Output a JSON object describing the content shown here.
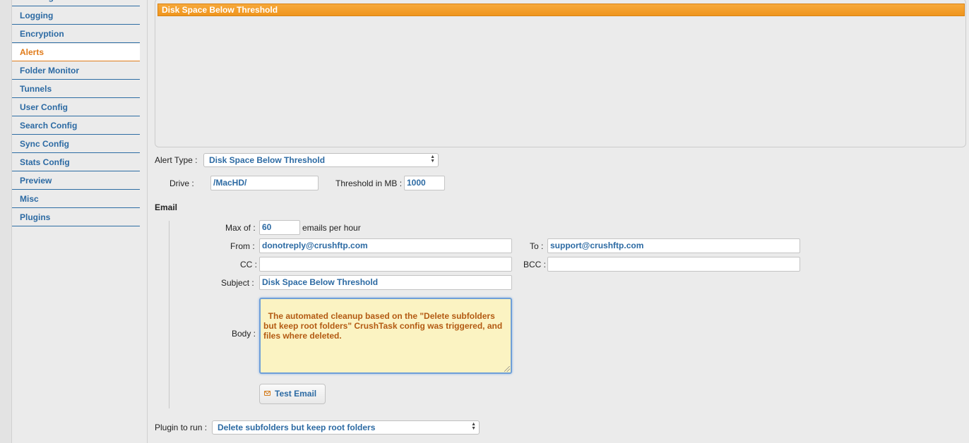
{
  "sidebar": {
    "items": [
      {
        "label": "Banning"
      },
      {
        "label": "Logging"
      },
      {
        "label": "Encryption"
      },
      {
        "label": "Alerts",
        "active": true
      },
      {
        "label": "Folder Monitor"
      },
      {
        "label": "Tunnels"
      },
      {
        "label": "User Config"
      },
      {
        "label": "Search Config"
      },
      {
        "label": "Sync Config"
      },
      {
        "label": "Stats Config"
      },
      {
        "label": "Preview"
      },
      {
        "label": "Misc"
      },
      {
        "label": "Plugins"
      }
    ]
  },
  "alerts_list": {
    "selected": "Disk Space Below Threshold"
  },
  "alert_type": {
    "label": "Alert Type :",
    "value": "Disk Space Below Threshold"
  },
  "drive": {
    "label": "Drive :",
    "value": "/MacHD/"
  },
  "threshold": {
    "label": "Threshold in MB :",
    "value": "1000"
  },
  "email": {
    "section_title": "Email",
    "max_label": "Max of :",
    "max_value": "60",
    "per_hour_label": "emails per hour",
    "from_label": "From :",
    "from_value": "donotreply@crushftp.com",
    "to_label": "To :",
    "to_value": "support@crushftp.com",
    "cc_label": "CC :",
    "cc_value": "",
    "bcc_label": "BCC :",
    "bcc_value": "",
    "subject_label": "Subject :",
    "subject_value": "Disk Space Below Threshold",
    "body_label": "Body :",
    "body_value": "The automated cleanup based on the \"Delete subfolders but keep root folders\" CrushTask config was triggered, and files where deleted.",
    "test_button": "Test Email"
  },
  "plugin": {
    "label": "Plugin to run :",
    "value": "Delete subfolders but keep root folders"
  },
  "colors": {
    "accent_blue": "#2c6aa3",
    "active_orange": "#e07b1a",
    "selection_orange": "#f39c24",
    "body_bg": "#fbf3c2",
    "body_text": "#b35a12"
  }
}
